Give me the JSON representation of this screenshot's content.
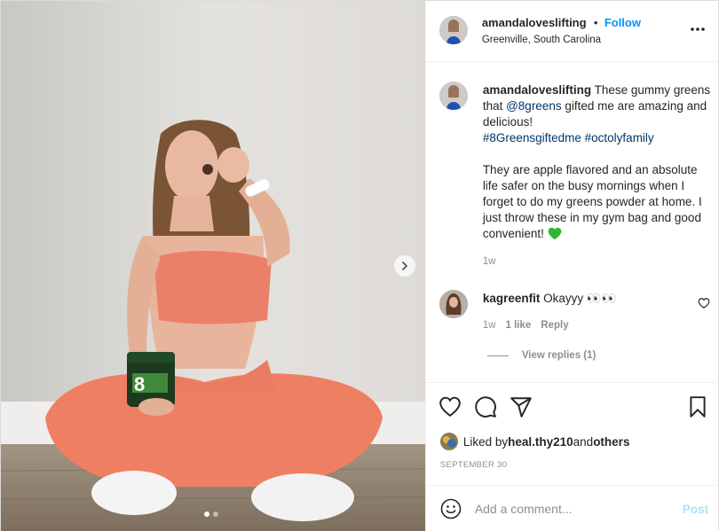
{
  "header": {
    "username": "amandaloveslifting",
    "separator": "•",
    "follow_label": "Follow",
    "location": "Greenville, South Carolina"
  },
  "caption": {
    "username": "amandaloveslifting",
    "text_part1": " These gummy greens that ",
    "mention": "@8greens",
    "text_part2": " gifted me are amazing and delicious!",
    "hashtag1": "#8Greensgiftedme",
    "hashtag2": "#octolyfamily",
    "paragraph2": "They are apple flavored and an absolute life safer on the busy mornings when I forget to do my greens powder at home. I just throw these in my gym bag and good convenient! ",
    "time": "1w"
  },
  "comment": {
    "username": "kagreenfit",
    "text": " Okayyy 👀👀",
    "time": "1w",
    "likes": "1 like",
    "reply_label": "Reply",
    "view_replies": "View replies (1)"
  },
  "likes": {
    "prefix": "Liked by ",
    "user": "heal.thy210",
    "and": " and ",
    "others": "others"
  },
  "date": "SEPTEMBER 30",
  "add_comment": {
    "placeholder": "Add a comment...",
    "post_label": "Post"
  },
  "carousel": {
    "slides": 2,
    "active_index": 0
  },
  "icons": [
    "chevron-right-icon",
    "more-icon",
    "heart-icon",
    "comment-icon",
    "share-icon",
    "bookmark-icon",
    "emoji-icon",
    "green-heart-icon",
    "small-heart-icon"
  ],
  "colors": {
    "link": "#0095f6",
    "tag": "#00376b",
    "muted": "#8e8e8e",
    "post_disabled": "#b2dffc",
    "green_heart": "#2fb52f"
  }
}
